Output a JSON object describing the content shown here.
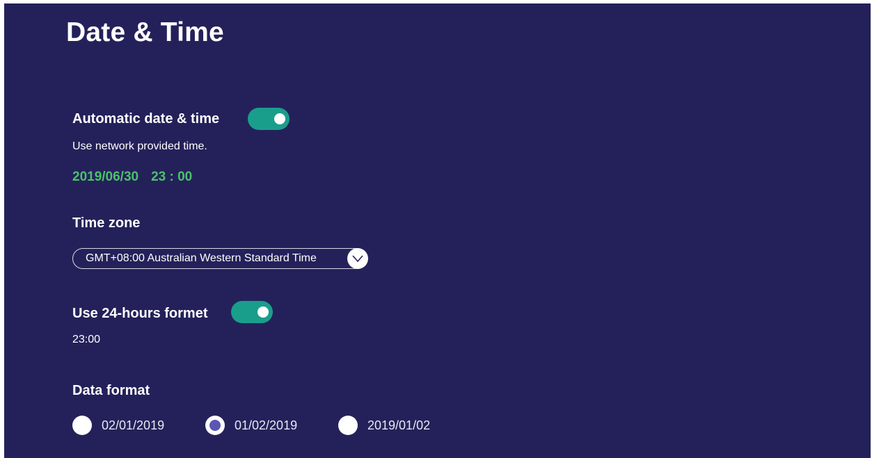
{
  "page": {
    "title": "Date & Time"
  },
  "automatic": {
    "label": "Automatic date & time",
    "enabled": true,
    "description": "Use network provided time.",
    "date": "2019/06/30",
    "time": "23 : 00"
  },
  "timezone": {
    "label": "Time zone",
    "selected": "GMT+08:00 Australian Western Standard Time",
    "dropdown_icon": "chevron-down-icon"
  },
  "hours24": {
    "label": "Use 24-hours formet",
    "enabled": true,
    "preview": "23:00"
  },
  "date_format": {
    "label": "Data format",
    "options": [
      {
        "label": "02/01/2019",
        "selected": false
      },
      {
        "label": "01/02/2019",
        "selected": true
      },
      {
        "label": "2019/01/02",
        "selected": false
      }
    ]
  },
  "colors": {
    "background": "#24215a",
    "toggle_on": "#1a9e8c",
    "accent_text": "#4cc16b",
    "radio_selected": "#5a56b4"
  }
}
